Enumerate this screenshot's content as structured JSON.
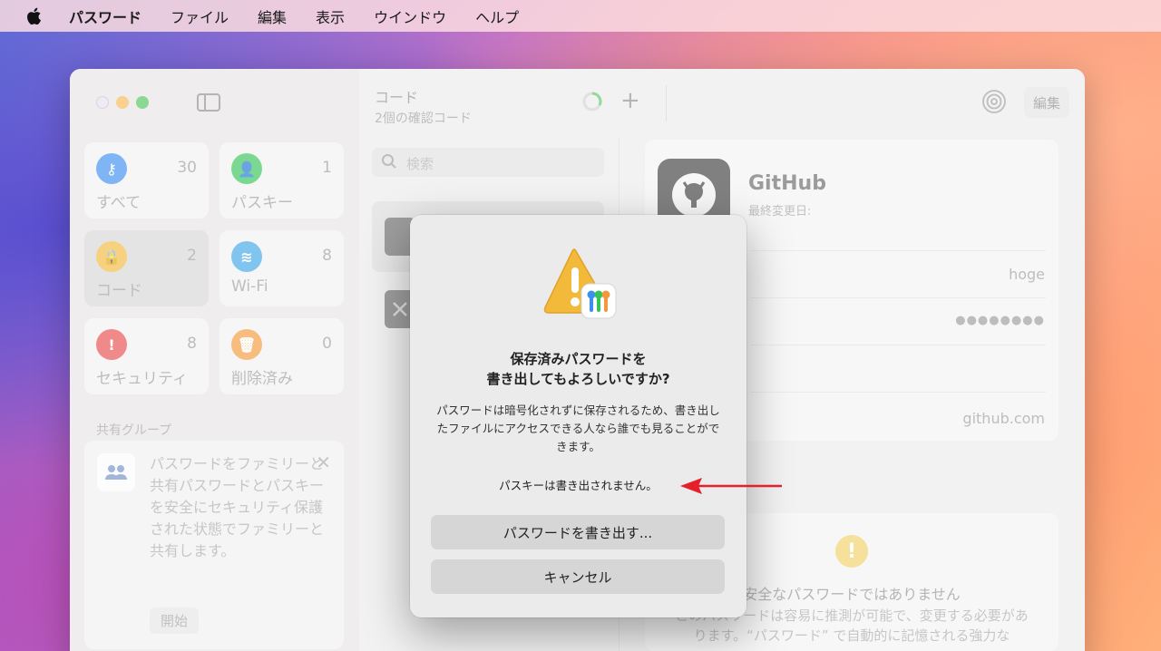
{
  "menubar": {
    "app": "パスワード",
    "items": [
      "ファイル",
      "編集",
      "表示",
      "ウインドウ",
      "ヘルプ"
    ]
  },
  "sidebar": {
    "tiles": [
      {
        "label": "すべて",
        "count": "30",
        "icon": "key-icon",
        "color": "#3d8ef0"
      },
      {
        "label": "パスキー",
        "count": "1",
        "icon": "person-key-icon",
        "color": "#34c45a"
      },
      {
        "label": "コード",
        "count": "2",
        "icon": "lock-icon",
        "color": "#f2b93b"
      },
      {
        "label": "Wi-Fi",
        "count": "8",
        "icon": "wifi-icon",
        "color": "#3da6e8"
      },
      {
        "label": "セキュリティ",
        "count": "8",
        "icon": "exclamation-icon",
        "color": "#e84c4c"
      },
      {
        "label": "削除済み",
        "count": "0",
        "icon": "trash-icon",
        "color": "#f29a3b"
      }
    ],
    "shared_group_title": "共有グループ",
    "share_card": {
      "text": "パスワードをファミリーと共有パスワードとパスキーを安全にセキュリティ保護された状態でファミリーと共有します。",
      "start_label": "開始"
    }
  },
  "list": {
    "title": "コード",
    "subtitle": "2個の確認コード",
    "search_placeholder": "検索"
  },
  "detail": {
    "name": "GitHub",
    "modified_label": "最終変更日:",
    "username": "hoge",
    "password_mask": "●●●●●●●●",
    "website": "github.com",
    "edit_label": "編集",
    "warning_title": "安全なパスワードではありません",
    "warning_body": "このパスワードは容易に推測が可能で、変更する必要があります。“パスワード” で自動的に記憶される強力な"
  },
  "dialog": {
    "title_line1": "保存済みパスワードを",
    "title_line2": "書き出してもよろしいですか?",
    "body": "パスワードは暗号化されずに保存されるため、書き出したファイルにアクセスできる人なら誰でも見ることができます。",
    "note": "パスキーは書き出されません。",
    "export_button": "パスワードを書き出す...",
    "cancel_button": "キャンセル"
  },
  "colors": {
    "arrow": "#e5202a",
    "warning_yellow": "#f2b93b"
  }
}
